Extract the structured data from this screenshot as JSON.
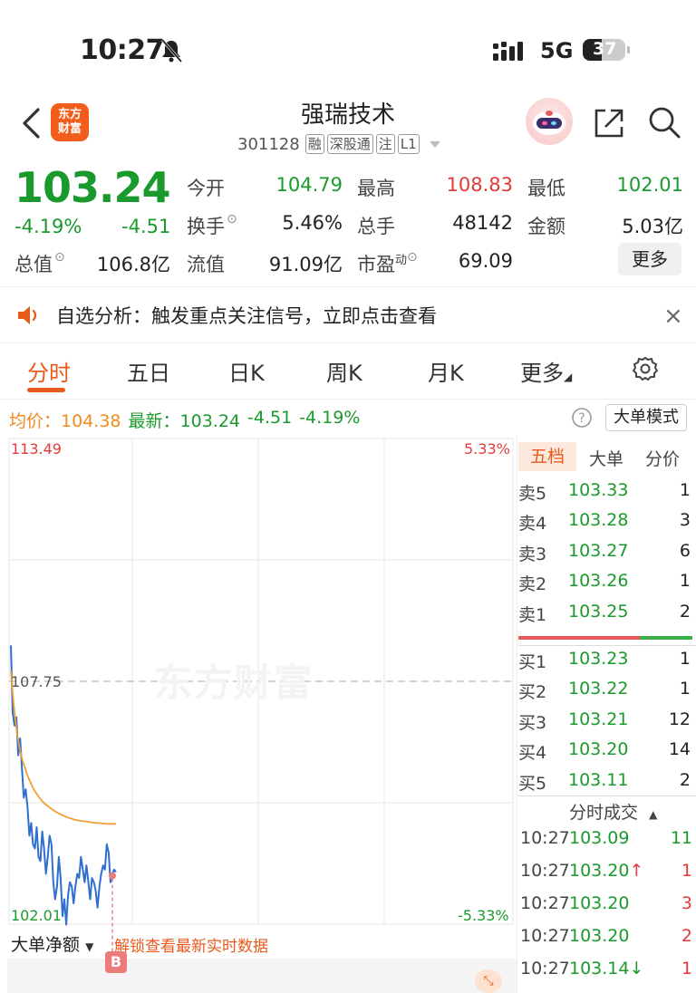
{
  "status": {
    "time": "10:27",
    "network": "5G",
    "battery": "37"
  },
  "header": {
    "logo_line1": "东方",
    "logo_line2": "财富",
    "title": "强瑞技术",
    "code": "301128",
    "tags": [
      "融",
      "深股通",
      "注",
      "L1"
    ]
  },
  "quote": {
    "price": "103.24",
    "change_pct": "-4.19%",
    "change": "-4.51",
    "fields": [
      {
        "label": "今开",
        "value": "104.79",
        "color": "#1a9a2c"
      },
      {
        "label": "最高",
        "value": "108.83",
        "color": "#e03a3a"
      },
      {
        "label": "最低",
        "value": "102.01",
        "color": "#1a9a2c"
      },
      {
        "label": "换手",
        "value": "5.46%",
        "color": "#222"
      },
      {
        "label": "总手",
        "value": "48142",
        "color": "#222"
      },
      {
        "label": "金额",
        "value": "5.03亿",
        "color": "#222"
      },
      {
        "label": "总值",
        "value": "106.8亿",
        "color": "#222"
      },
      {
        "label": "流值",
        "value": "91.09亿",
        "color": "#222"
      },
      {
        "label": "市盈",
        "value": "69.09",
        "color": "#222"
      }
    ],
    "pe_sup": "动",
    "more_label": "更多"
  },
  "notice": {
    "text": "自选分析：触发重点关注信号，立即点击查看",
    "close": "×"
  },
  "tabs": [
    "分时",
    "五日",
    "日K",
    "周K",
    "月K",
    "更多"
  ],
  "indicators": {
    "avg_label": "均价：",
    "avg_value": "104.38",
    "latest_label": "最新：",
    "latest_value": "103.24",
    "latest_change": "-4.51",
    "latest_pct": "-4.19%",
    "mode_button": "大单模式"
  },
  "chart_data": {
    "type": "line",
    "title": "",
    "ylim": [
      102.01,
      113.49
    ],
    "y_labels": {
      "top": "113.49",
      "mid": "107.75",
      "bottom": "102.01"
    },
    "pct_labels": {
      "top": "5.33%",
      "bottom": "-5.33%"
    },
    "prev_close": 107.75,
    "series": [
      {
        "name": "最新",
        "color": "#2f6fd0",
        "values": [
          108.6,
          107.0,
          106.7,
          106.9,
          106.0,
          106.4,
          105.7,
          105.0,
          105.2,
          104.8,
          104.1,
          104.4,
          103.9,
          103.8,
          104.3,
          103.6,
          103.5,
          104.2,
          103.8,
          103.2,
          103.6,
          104.1,
          103.9,
          103.0,
          102.6,
          102.9,
          103.6,
          103.1,
          102.2,
          102.6,
          102.0,
          102.7,
          103.0,
          102.9,
          102.5,
          102.9,
          103.2,
          103.1,
          103.6,
          103.3,
          103.0,
          103.4,
          103.0,
          102.6,
          103.1,
          103.0,
          102.8,
          102.4,
          102.9,
          103.2,
          103.4,
          103.3,
          103.9,
          103.7,
          103.0,
          103.2,
          103.3,
          103.24
        ]
      },
      {
        "name": "均价",
        "color": "#f0a030",
        "values": [
          108.0,
          107.2,
          106.6,
          106.2,
          105.9,
          105.7,
          105.5,
          105.35,
          105.2,
          105.1,
          105.0,
          104.92,
          104.85,
          104.8,
          104.75,
          104.7,
          104.66,
          104.62,
          104.59,
          104.56,
          104.53,
          104.51,
          104.49,
          104.47,
          104.46,
          104.45,
          104.44,
          104.43,
          104.42,
          104.41,
          104.4,
          104.4,
          104.39,
          104.39,
          104.38,
          104.38,
          104.38,
          104.38
        ]
      }
    ]
  },
  "chart_footer": {
    "select_label": "大单净额",
    "unlock_text": "解锁查看最新实时数据",
    "badge": "B"
  },
  "order_book": {
    "tabs": [
      "五档",
      "大单",
      "分价"
    ],
    "sells": [
      {
        "label": "卖5",
        "price": "103.33",
        "qty": "1"
      },
      {
        "label": "卖4",
        "price": "103.28",
        "qty": "3"
      },
      {
        "label": "卖3",
        "price": "103.27",
        "qty": "6"
      },
      {
        "label": "卖2",
        "price": "103.26",
        "qty": "1"
      },
      {
        "label": "卖1",
        "price": "103.25",
        "qty": "2"
      }
    ],
    "buys": [
      {
        "label": "买1",
        "price": "103.23",
        "qty": "1"
      },
      {
        "label": "买2",
        "price": "103.22",
        "qty": "1"
      },
      {
        "label": "买3",
        "price": "103.21",
        "qty": "12"
      },
      {
        "label": "买4",
        "price": "103.20",
        "qty": "14"
      },
      {
        "label": "买5",
        "price": "103.11",
        "qty": "2"
      }
    ]
  },
  "trades": {
    "title": "分时成交",
    "rows": [
      {
        "time": "10:27",
        "price": "103.09",
        "arrow": "",
        "vol": "11",
        "color": "#1a9a2c"
      },
      {
        "time": "10:27",
        "price": "103.20",
        "arrow": "↑",
        "vol": "1",
        "color": "#e03a3a"
      },
      {
        "time": "10:27",
        "price": "103.20",
        "arrow": "",
        "vol": "3",
        "color": "#e03a3a"
      },
      {
        "time": "10:27",
        "price": "103.20",
        "arrow": "",
        "vol": "2",
        "color": "#e03a3a"
      },
      {
        "time": "10:27",
        "price": "103.14",
        "arrow": "↓",
        "vol": "1",
        "color": "#e03a3a"
      }
    ]
  }
}
